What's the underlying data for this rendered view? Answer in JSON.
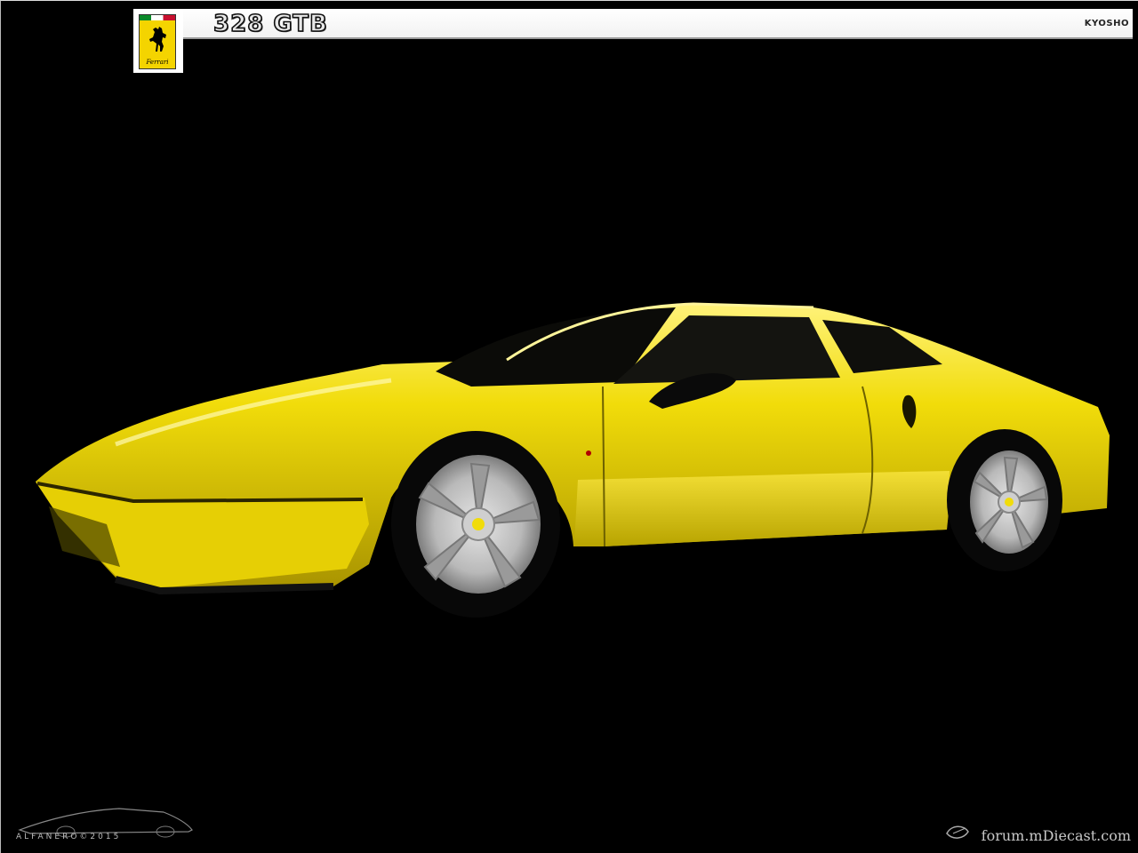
{
  "header": {
    "title": "328 GTB",
    "brand": "KYOSHO"
  },
  "badge": {
    "word": "Ferrari",
    "colors": {
      "field": "#f4d400",
      "green": "#0b8a2a",
      "red": "#c8102e"
    },
    "icon": "prancing-horse-icon"
  },
  "photo": {
    "car_color": "#f1dc0a",
    "background": "#000000"
  },
  "footer": {
    "signature": "ALFANERO©2015",
    "site": "forum.mDiecast.com"
  }
}
